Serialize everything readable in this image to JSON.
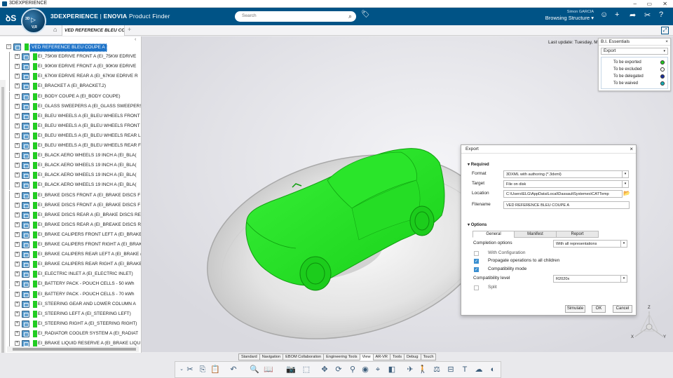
{
  "window": {
    "title": "3DEXPERIENCE",
    "controls": [
      "–",
      "▭",
      "✕"
    ]
  },
  "header": {
    "brand": "3DEXPERIENCE",
    "app": "ENOVIA",
    "app_sub": "Product Finder",
    "compass_label": "3D",
    "compass_version": "V,R",
    "search_placeholder": "Search",
    "user_name": "Simon GARCIA",
    "context": "Browsing Structure"
  },
  "tab": {
    "label": "VED REFERENCE  BLEU CO"
  },
  "tree": {
    "root": "VED REFERENCE  BLEU COUPE A",
    "items": [
      "EI_75KW EDRIVE FRONT A (EI_75KW EDRIVE",
      "EI_90KW EDRIVE FRONT A (EI_90KW EDRIVE",
      "EI_67KW EDRIVE REAR A (EI_67KW EDRIVE R",
      "EI_BRACKET A (EI_BRACKET.2)",
      "EI_BODY COUPE A (EI_BODY COUPE)",
      "EI_GLASS SWEEPERS A (EI_GLASS SWEEPERS)",
      "EI_BLEU WHEELS A (EI_BLEU WHEELS FRONT",
      "EI_BLEU WHEELS A (EI_BLEU WHEELS FRONT",
      "EI_BLEU WHEELS A (EI_BLEU WHEELS REAR L",
      "EI_BLEU WHEELS A (EI_BLEU WHEELS REAR F",
      "EI_BLACK AERO WHEELS 19 INCH A (EI_BLA(",
      "EI_BLACK AERO WHEELS 19 INCH A (EI_BLA(",
      "EI_BLACK AERO WHEELS 19 INCH A (EI_BLA(",
      "EI_BLACK AERO WHEELS 19 INCH A (EI_BLA(",
      "EI_BRAKE DISCS FRONT A (EI_BRAKE DISCS F",
      "EI_BRAKE DISCS FRONT A (EI_BRAKE DISCS F",
      "EI_BRAKE DISCS REAR A (EI_BRAKE DISCS RE",
      "EI_BRAKE DISCS REAR A (EI_BREAKE DISCS RI",
      "EI_BRAKE CALIPERS FRONT LEFT A (EI_BRAKE",
      "EI_BRAKE CALIPERS FRONT RIGHT A (EI_BRAK",
      "EI_BRAKE CALIPERS REAR LEFT A (EI_BRAKE (",
      "EI_BRAKE CALIPERS REAR RIGHT A (EI_BRAKE",
      "EI_ELECTRIC INLET A (EI_ELECTRIC INLET)",
      "EI_BATTERY PACK - POUCH CELLS - 50 kWh",
      "EI_BATTERY PACK - POUCH CELLS - 70 kWh",
      "EI_STEERING GEAR AND LOWER COLUMN A",
      "EI_STEERING LEFT A (EI_STEERING LEFT)",
      "EI_STEERING RIGHT A (EI_STEERING RIGHT)",
      "EI_RADIATOR COOLER SYSTEM A (EI_RADIAT",
      "EI_BRAKE LIQUID RESERVE A (EI_BRAKE LIQU"
    ]
  },
  "last_update": "Last update: Tuesday, Marc",
  "bi": {
    "title": "B.I. Essentials",
    "selected": "Export",
    "legend": [
      {
        "label": "To be exported",
        "color": "#22cc22"
      },
      {
        "label": "To be excluded",
        "color": "#ffffff"
      },
      {
        "label": "To be delegated",
        "color": "#1a2f9e"
      },
      {
        "label": "To be waived",
        "color": "#14b0b8"
      }
    ]
  },
  "export": {
    "title": "Export",
    "required_label": "Required",
    "format_label": "Format",
    "format_value": "3DXML with authoring (*.3dxml)",
    "target_label": "Target",
    "target_value": "File on disk",
    "location_label": "Location",
    "location_value": "C:\\Users\\ELG\\AppData\\Local\\DassaultSystemes\\CATTemp",
    "filename_label": "Filename",
    "filename_value": "VED REFERENCE  BLEU COUPE A",
    "options_label": "Options",
    "tabs": [
      "General",
      "Manifest",
      "Report"
    ],
    "completion_label": "Completion options",
    "completion_value": "With all representations",
    "with_configuration": "With Configuration",
    "propagate": "Propagate operations to all children",
    "compat_mode": "Compatibility mode",
    "compat_level_label": "Compatibility level",
    "compat_level_value": "R2020x",
    "split": "Split",
    "btn_simulate": "Simulate",
    "btn_ok": "OK",
    "btn_cancel": "Cancel"
  },
  "axis": {
    "x": "X",
    "y": "Y",
    "z": "Z"
  },
  "bottom_tabs": [
    "Standard",
    "Navigation",
    "EBOM Collaboration",
    "Engineering Tools",
    "View",
    "AR-VR",
    "Tools",
    "Debug",
    "Touch"
  ],
  "colors": {
    "brand": "#005386",
    "highlight": "#22ee22",
    "selection": "#1e73c8"
  }
}
